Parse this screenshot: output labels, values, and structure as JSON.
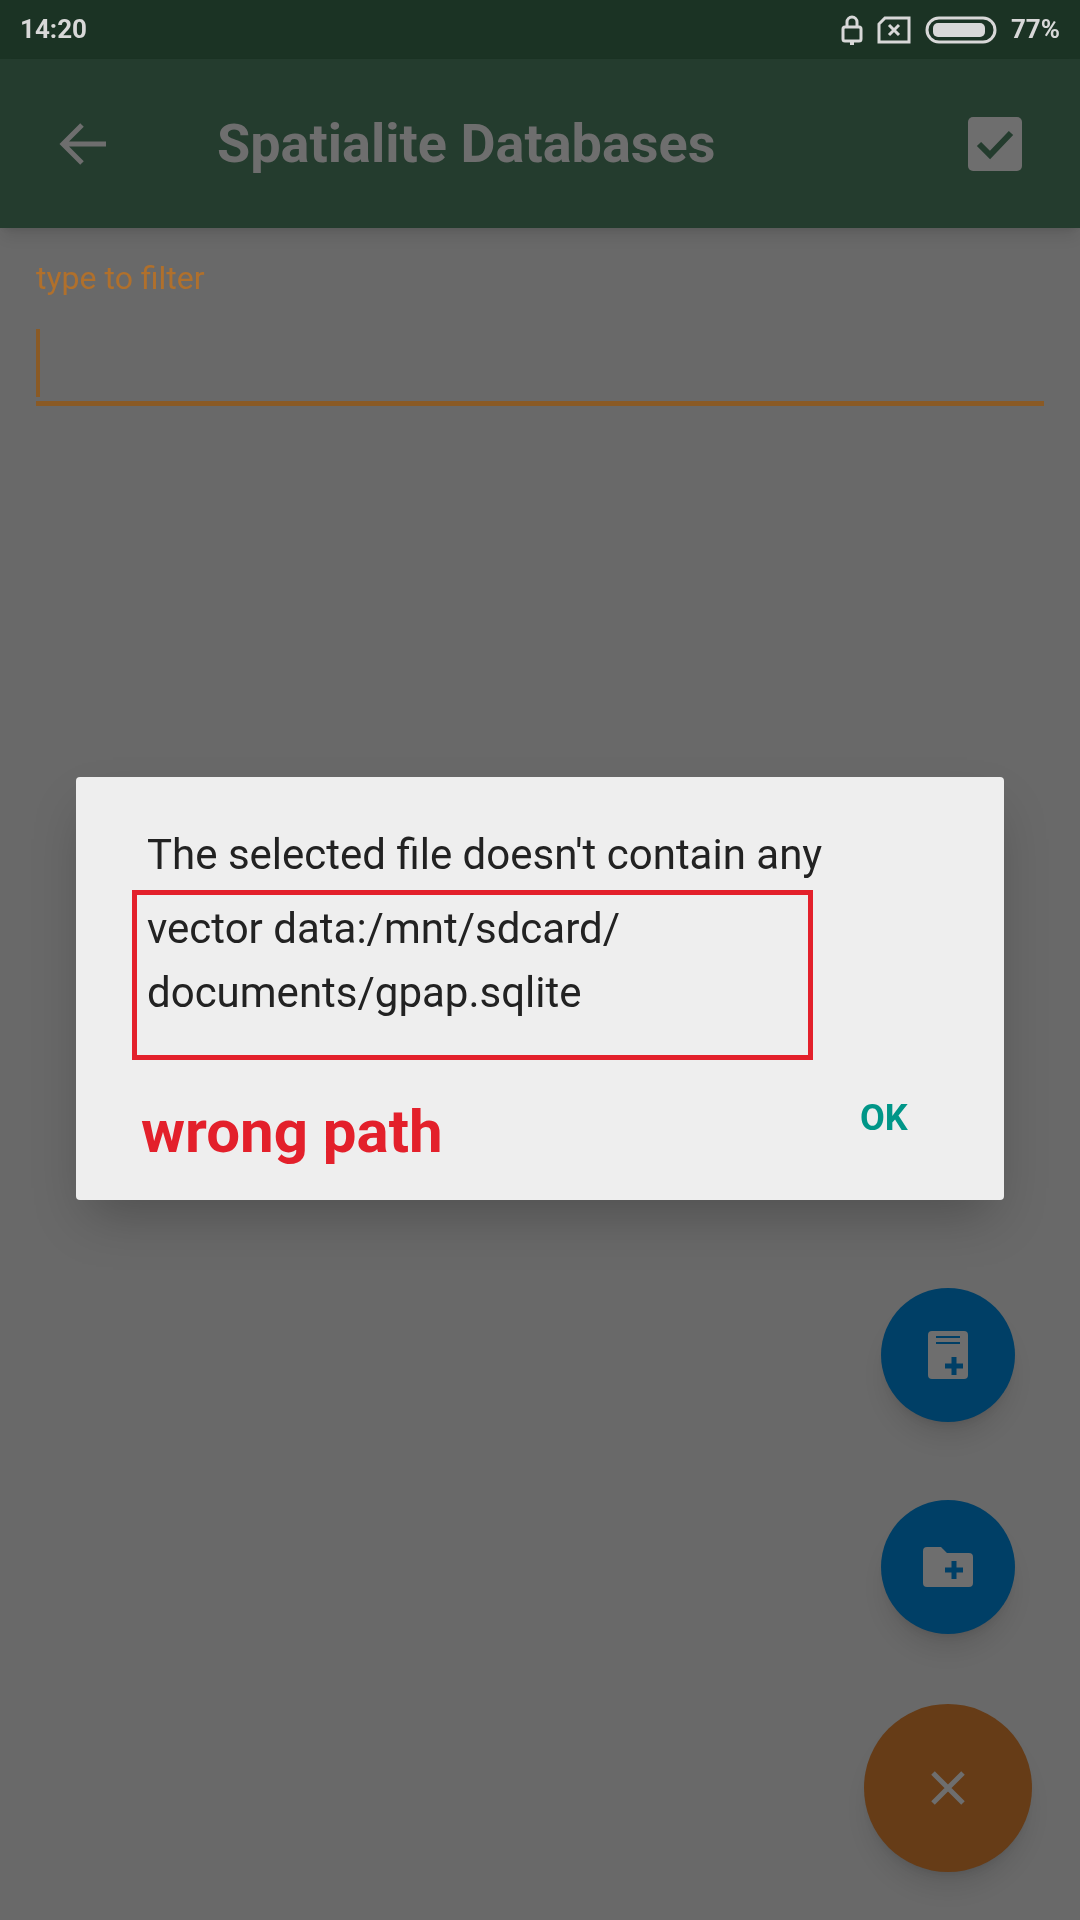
{
  "status_bar": {
    "time": "14:20",
    "battery": "77%"
  },
  "app_bar": {
    "title": "Spatialite Databases"
  },
  "filter": {
    "label": "type to filter"
  },
  "dialog": {
    "message": "The selected file doesn't contain any",
    "highlighted_lines": [
      "vector data:/mnt/sdcard/",
      "documents/gpap.sqlite"
    ],
    "button": "OK"
  },
  "annotation": {
    "label": "wrong path"
  }
}
